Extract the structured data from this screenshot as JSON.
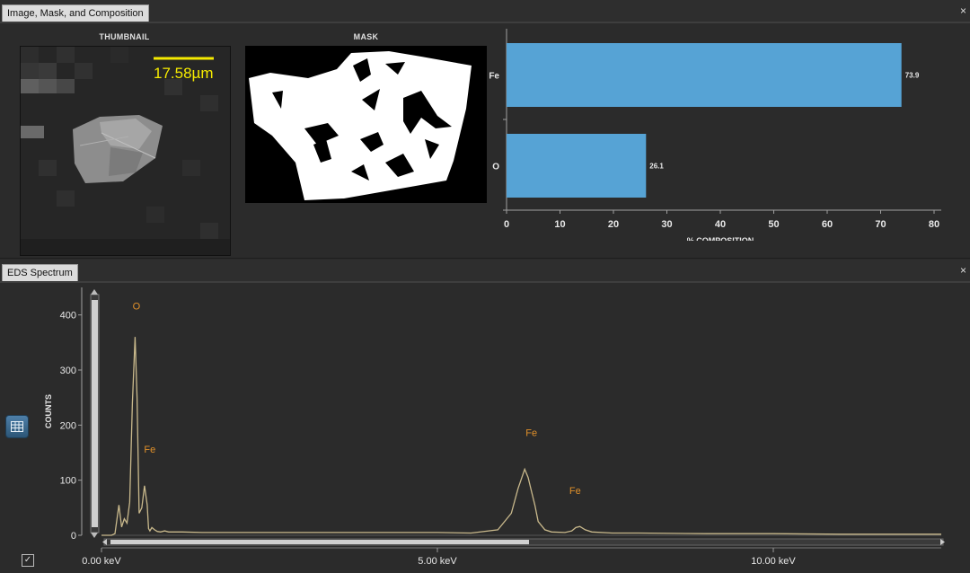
{
  "top_panel": {
    "tab_title": "Image, Mask, and Composition",
    "thumbnail_label": "THUMBNAIL",
    "mask_label": "MASK",
    "scale_bar_text": "17.58µm",
    "close_glyph": "×"
  },
  "bottom_panel": {
    "tab_title": "EDS Spectrum",
    "close_glyph": "×",
    "table_button_icon": "table-icon",
    "checkbox_glyph": "✓"
  },
  "colors": {
    "bar": "#56a3d5",
    "spectrum_line": "#c9b98c",
    "peak_label": "#e0902a",
    "scale_bar": "#f5ea00"
  },
  "chart_data": [
    {
      "type": "bar",
      "orientation": "horizontal",
      "categories": [
        "Fe",
        "O"
      ],
      "values": [
        73.9,
        26.1
      ],
      "data_labels": [
        "73.9",
        "26.1"
      ],
      "xlabel": "% COMPOSITION",
      "xlim": [
        0,
        80
      ],
      "xticks": [
        0,
        10,
        20,
        30,
        40,
        50,
        60,
        70,
        80
      ],
      "grid": false
    },
    {
      "type": "line",
      "ylabel": "COUNTS",
      "ylim": [
        0,
        450
      ],
      "yticks": [
        0,
        100,
        200,
        300,
        400
      ],
      "xlim_kev": [
        0,
        12.5
      ],
      "xtick_labels": [
        {
          "v": 0,
          "label": "0.00 keV"
        },
        {
          "v": 5,
          "label": "5.00 keV"
        },
        {
          "v": 10,
          "label": "10.00 keV"
        }
      ],
      "series": [
        {
          "x": [
            0.0,
            0.15,
            0.2,
            0.26,
            0.3,
            0.34,
            0.38,
            0.42,
            0.46,
            0.5,
            0.53,
            0.56,
            0.6,
            0.64,
            0.68,
            0.7,
            0.72,
            0.75,
            0.79,
            0.83,
            0.88,
            0.94,
            1.0,
            1.2,
            1.5,
            2.0,
            2.5,
            3.0,
            3.5,
            4.0,
            4.5,
            5.0,
            5.5,
            5.9,
            6.1,
            6.2,
            6.3,
            6.35,
            6.4,
            6.45,
            6.5,
            6.6,
            6.7,
            6.9,
            7.0,
            7.06,
            7.12,
            7.2,
            7.3,
            7.6,
            8.0,
            9.0,
            10.0,
            11.0,
            12.0,
            12.5
          ],
          "y": [
            0,
            0,
            3,
            55,
            15,
            30,
            22,
            60,
            240,
            360,
            250,
            40,
            50,
            90,
            55,
            12,
            8,
            14,
            10,
            7,
            6,
            8,
            6,
            6,
            5,
            5,
            5,
            5,
            5,
            5,
            5,
            5,
            4,
            10,
            40,
            85,
            120,
            105,
            80,
            55,
            25,
            10,
            6,
            5,
            8,
            14,
            16,
            10,
            6,
            4,
            4,
            3,
            3,
            2,
            2,
            2
          ]
        }
      ],
      "peak_labels": [
        {
          "text": "O",
          "x": 0.52,
          "y": 410
        },
        {
          "text": "Fe",
          "x": 0.72,
          "y": 150
        },
        {
          "text": "Fe",
          "x": 6.4,
          "y": 180
        },
        {
          "text": "Fe",
          "x": 7.05,
          "y": 75
        }
      ]
    }
  ]
}
